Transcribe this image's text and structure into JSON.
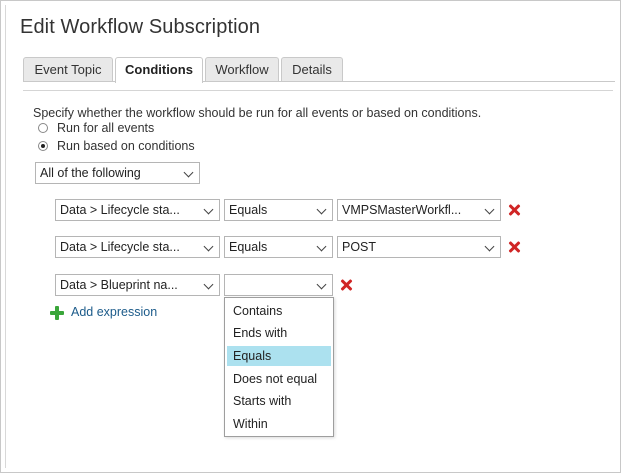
{
  "title": "Edit Workflow Subscription",
  "tabs": [
    {
      "label": "Event Topic"
    },
    {
      "label": "Conditions"
    },
    {
      "label": "Workflow"
    },
    {
      "label": "Details"
    }
  ],
  "active_tab": "Conditions",
  "description": "Specify whether the workflow should be run for all events or based on conditions.",
  "radios": [
    {
      "label": "Run for all events",
      "checked": false
    },
    {
      "label": "Run based on conditions",
      "checked": true
    }
  ],
  "logic_select": "All of the following",
  "expressions": [
    {
      "field": "Data > Lifecycle sta...",
      "operator": "Equals",
      "value": "VMPSMasterWorkfl..."
    },
    {
      "field": "Data > Lifecycle sta...",
      "operator": "Equals",
      "value": "POST"
    },
    {
      "field": "Data > Blueprint na...",
      "operator": "",
      "value": null
    }
  ],
  "add_expression_label": "Add expression",
  "operator_options": [
    "Contains",
    "Ends with",
    "Equals",
    "Does not equal",
    "Starts with",
    "Within"
  ],
  "highlighted_option": "Equals",
  "colors": {
    "remove": "#d02525",
    "add": "#3aa63a",
    "link": "#1c5b8a",
    "highlight": "#ace1ef"
  }
}
